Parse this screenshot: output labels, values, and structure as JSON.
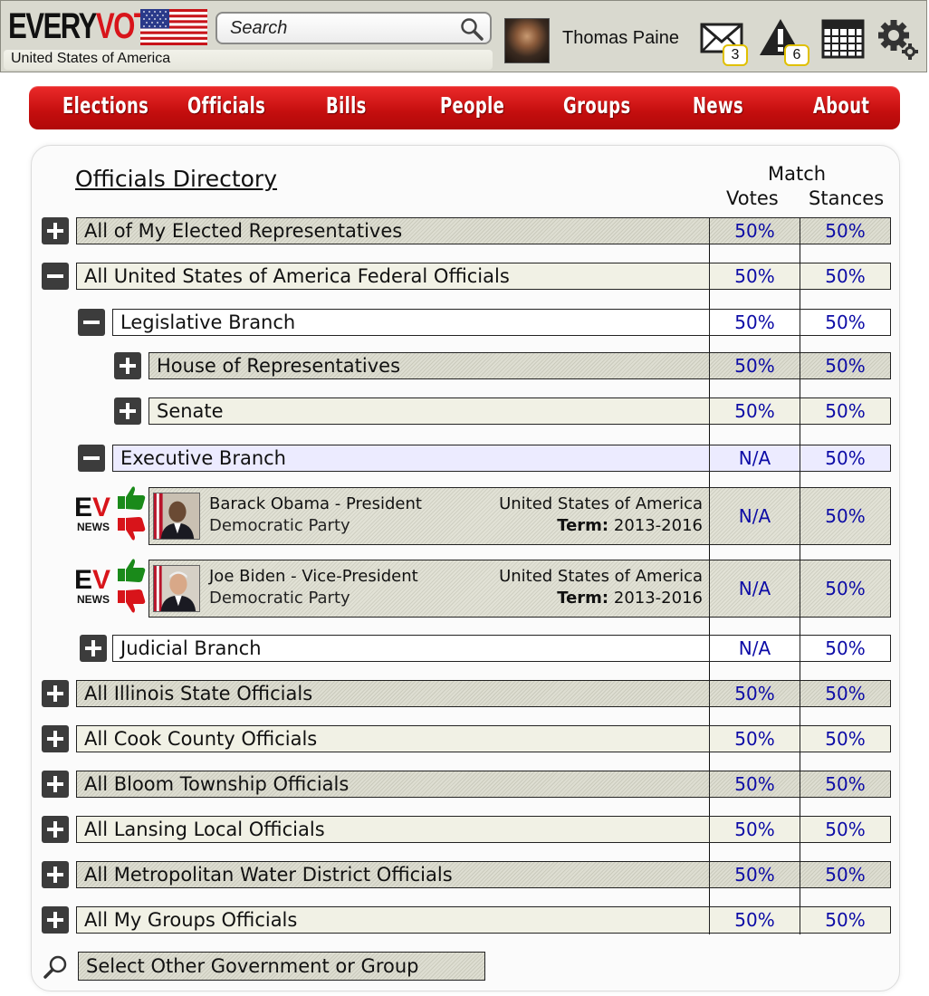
{
  "header": {
    "logo_every": "EVERY",
    "logo_vote": "VOTE",
    "country": "United States of America",
    "search_placeholder": "Search",
    "username": "Thomas Paine",
    "mail_count": "3",
    "alert_count": "6"
  },
  "nav": {
    "items": [
      "Elections",
      "Officials",
      "Bills",
      "People",
      "Groups",
      "News",
      "About"
    ]
  },
  "directory": {
    "title": "Officials Directory",
    "match_label": "Match",
    "votes_label": "Votes",
    "stances_label": "Stances",
    "rows": [
      {
        "label": "All of My Elected Representatives",
        "votes": "50%",
        "stances": "50%",
        "toggle": "plus"
      },
      {
        "label": "All United States of America Federal Officials",
        "votes": "50%",
        "stances": "50%",
        "toggle": "minus"
      },
      {
        "label": "Legislative Branch",
        "votes": "50%",
        "stances": "50%",
        "toggle": "minus"
      },
      {
        "label": "House of Representatives",
        "votes": "50%",
        "stances": "50%",
        "toggle": "plus"
      },
      {
        "label": "Senate",
        "votes": "50%",
        "stances": "50%",
        "toggle": "plus"
      },
      {
        "label": "Executive Branch",
        "votes": "N/A",
        "stances": "50%",
        "toggle": "minus"
      },
      {
        "label": "Judicial Branch",
        "votes": "N/A",
        "stances": "50%",
        "toggle": "plus"
      },
      {
        "label": "All Illinois State Officials",
        "votes": "50%",
        "stances": "50%",
        "toggle": "plus"
      },
      {
        "label": "All Cook County Officials",
        "votes": "50%",
        "stances": "50%",
        "toggle": "plus"
      },
      {
        "label": "All Bloom Township Officials",
        "votes": "50%",
        "stances": "50%",
        "toggle": "plus"
      },
      {
        "label": "All Lansing Local Officials",
        "votes": "50%",
        "stances": "50%",
        "toggle": "plus"
      },
      {
        "label": "All Metropolitan Water District Officials",
        "votes": "50%",
        "stances": "50%",
        "toggle": "plus"
      },
      {
        "label": "All My Groups Officials",
        "votes": "50%",
        "stances": "50%",
        "toggle": "plus"
      }
    ],
    "officials": [
      {
        "name": "Barack Obama - President",
        "party": "Democratic Party",
        "country": "United States of America",
        "term_label": "Term:",
        "term": "2013-2016",
        "votes": "N/A",
        "stances": "50%"
      },
      {
        "name": "Joe Biden - Vice-President",
        "party": "Democratic Party",
        "country": "United States of America",
        "term_label": "Term:",
        "term": "2013-2016",
        "votes": "N/A",
        "stances": "50%"
      }
    ],
    "ev_label": "EV",
    "news_label": "NEWS",
    "select_other": "Select Other Government or Group"
  }
}
